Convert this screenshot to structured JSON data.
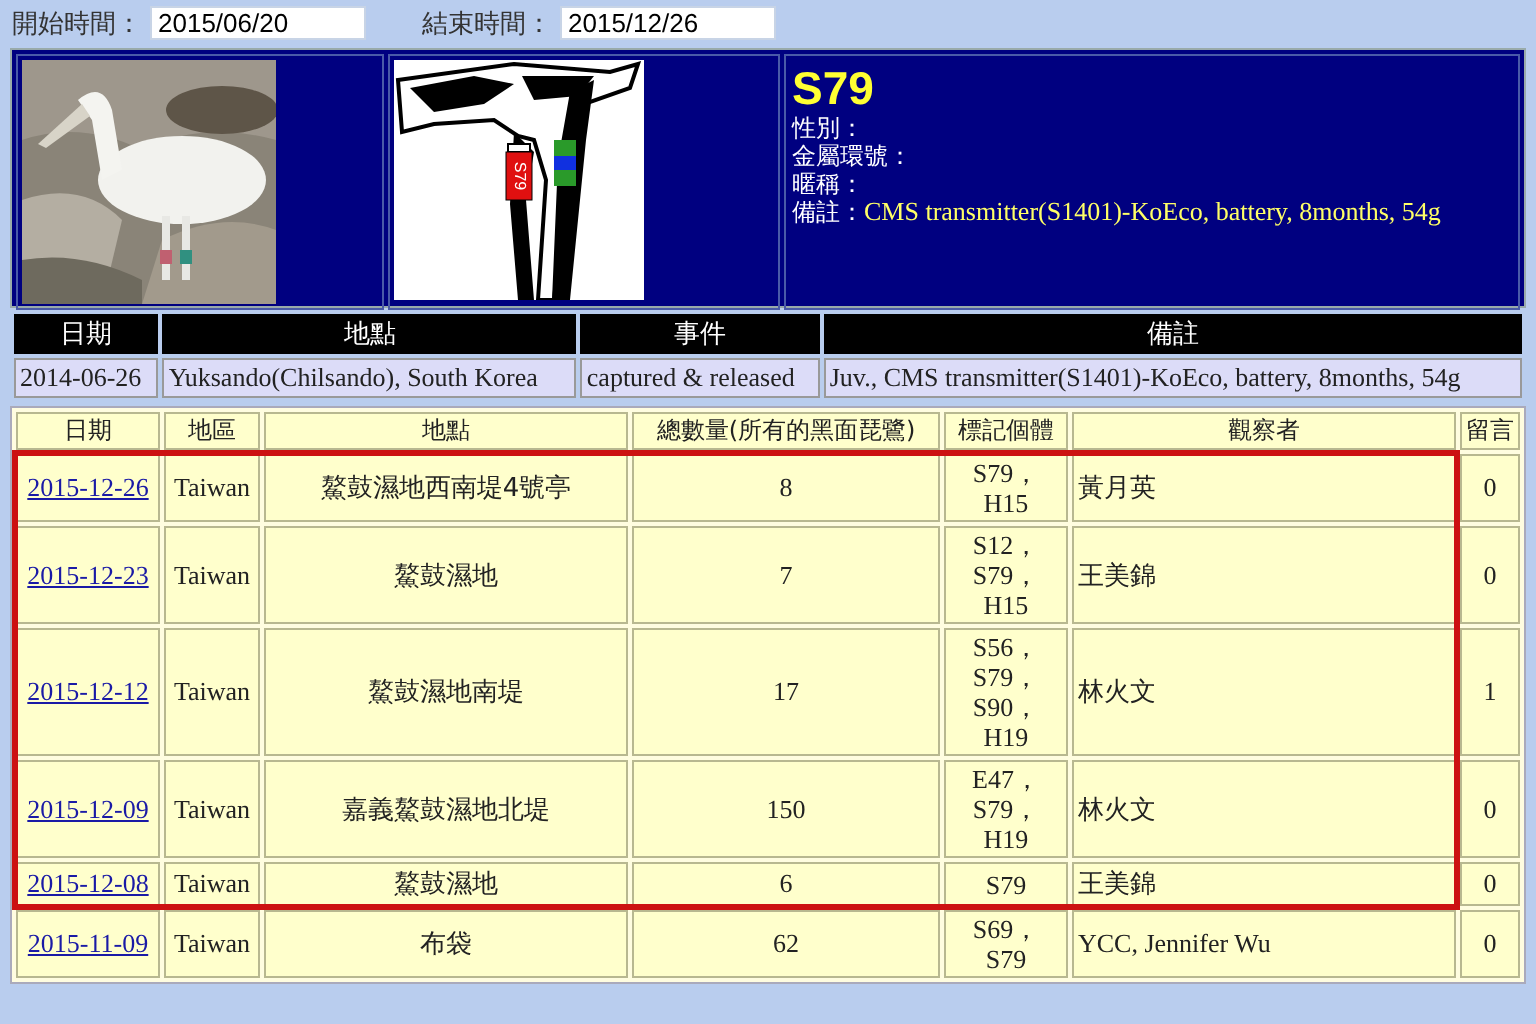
{
  "filter": {
    "start_label": "開始時間：",
    "start_value": "2015/06/20",
    "end_label": "結束時間：",
    "end_value": "2015/12/26"
  },
  "bird": {
    "band_label": "S79",
    "name": "S79",
    "fields": [
      {
        "label": "性別："
      },
      {
        "label": "金屬環號："
      },
      {
        "label": "暱稱："
      },
      {
        "label": "備註：",
        "value": "CMS transmitter(S1401)-KoEco, battery, 8months, 54g"
      }
    ]
  },
  "capture": {
    "columns": [
      "日期",
      "地點",
      "事件",
      "備註"
    ],
    "rows": [
      [
        "2014-06-26",
        "Yuksando(Chilsando), South Korea",
        "captured & released",
        "Juv., CMS transmitter(S1401)-KoEco, battery, 8months, 54g"
      ]
    ]
  },
  "sightings": {
    "columns": [
      "日期",
      "地區",
      "地點",
      "總數量(所有的黑面琵鷺)",
      "標記個體",
      "觀察者",
      "留言"
    ],
    "rows": [
      {
        "date": "2015-12-26",
        "region": "Taiwan",
        "place": "鰲鼓濕地西南堤4號亭",
        "count": "8",
        "markers": [
          "S79，",
          "H15"
        ],
        "observer": "黃月英",
        "comments": "0",
        "highlighted": true
      },
      {
        "date": "2015-12-23",
        "region": "Taiwan",
        "place": "鰲鼓濕地",
        "count": "7",
        "markers": [
          "S12，",
          "S79，",
          "H15"
        ],
        "observer": "王美錦",
        "comments": "0",
        "highlighted": true
      },
      {
        "date": "2015-12-12",
        "region": "Taiwan",
        "place": "鰲鼓濕地南堤",
        "count": "17",
        "markers": [
          "S56，",
          "S79，",
          "S90，",
          "H19"
        ],
        "observer": "林火文",
        "comments": "1",
        "highlighted": true
      },
      {
        "date": "2015-12-09",
        "region": "Taiwan",
        "place": "嘉義鰲鼓濕地北堤",
        "count": "150",
        "markers": [
          "E47，",
          "S79，",
          "H19"
        ],
        "observer": "林火文",
        "comments": "0",
        "highlighted": true
      },
      {
        "date": "2015-12-08",
        "region": "Taiwan",
        "place": "鰲鼓濕地",
        "count": "6",
        "markers": [
          "S79"
        ],
        "observer": "王美錦",
        "comments": "0",
        "highlighted": true
      },
      {
        "date": "2015-11-09",
        "region": "Taiwan",
        "place": "布袋",
        "count": "62",
        "markers": [
          "S69，",
          "S79"
        ],
        "observer": "YCC, Jennifer Wu",
        "comments": "0",
        "highlighted": false
      }
    ]
  }
}
